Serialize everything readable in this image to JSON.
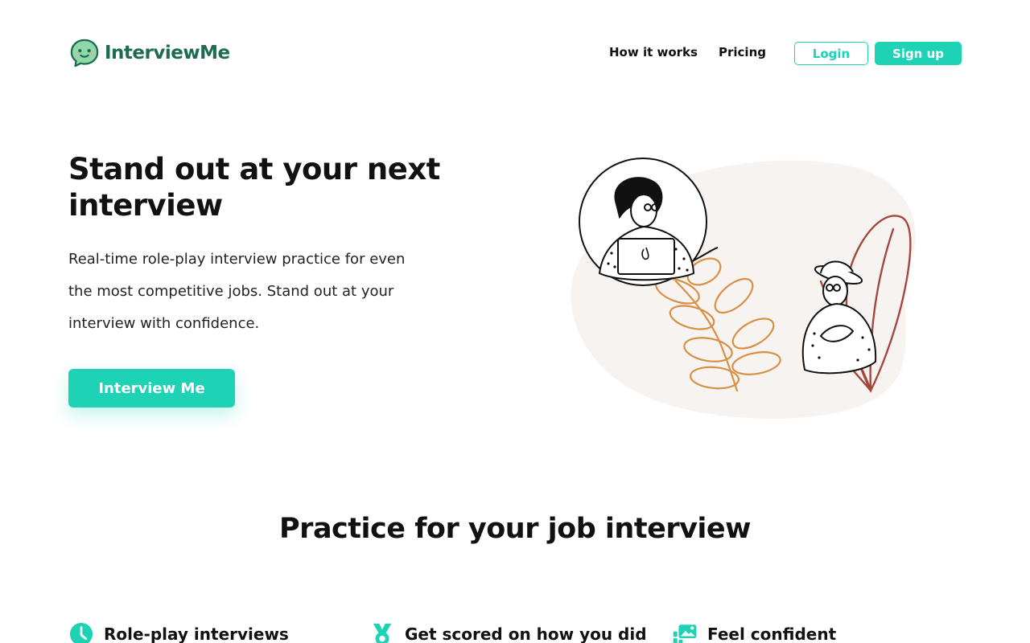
{
  "brand": {
    "name": "InterviewMe"
  },
  "nav": {
    "links": [
      {
        "label": "How it works"
      },
      {
        "label": "Pricing"
      }
    ],
    "login_label": "Login",
    "signup_label": "Sign up"
  },
  "hero": {
    "title": "Stand out at your next interview",
    "subtitle": "Real-time role-play interview practice for even the most competitive jobs. Stand out at your interview with confidence.",
    "cta_label": "Interview Me"
  },
  "features_section": {
    "title": "Practice for your job interview",
    "items": [
      {
        "label": "Role-play interviews",
        "icon": "clock-icon"
      },
      {
        "label": "Get scored on how you did",
        "icon": "medal-icon"
      },
      {
        "label": "Feel confident",
        "icon": "gallery-icon"
      }
    ]
  },
  "colors": {
    "accent": "#1ed3b5",
    "brand_text": "#1d6b52",
    "illustration_blob": "#f7f3f1"
  }
}
